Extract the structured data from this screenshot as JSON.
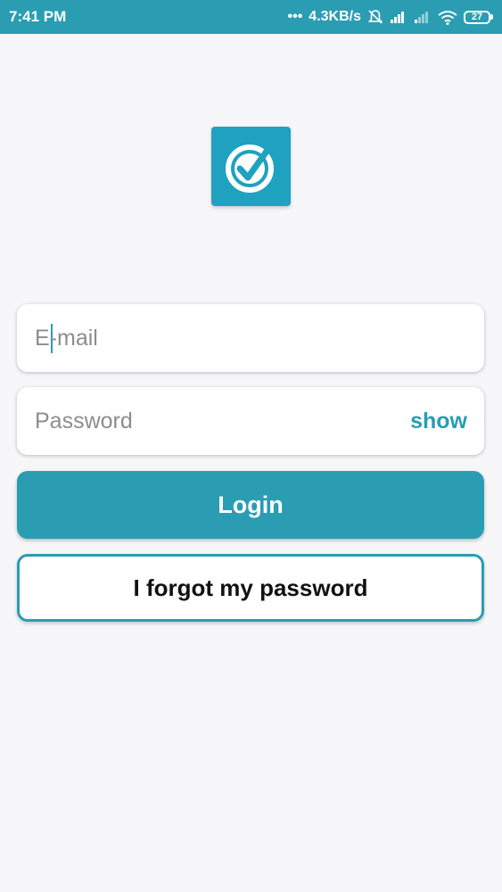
{
  "status_bar": {
    "time": "7:41 PM",
    "network_speed": "4.3KB/s",
    "battery_level": "27",
    "icons": [
      "dots-icon",
      "mute-bell-icon",
      "signal-icon",
      "signal-weak-icon",
      "wifi-icon",
      "battery-icon"
    ]
  },
  "logo": {
    "icon": "check-circle-icon",
    "color": "#1ea2bf"
  },
  "form": {
    "email_placeholder": "E-mail",
    "email_value": "",
    "password_placeholder": "Password",
    "password_value": "",
    "show_label": "show"
  },
  "buttons": {
    "login_label": "Login",
    "forgot_label": "I forgot my password"
  },
  "colors": {
    "accent": "#2a9db3",
    "background": "#f7f7f9"
  }
}
